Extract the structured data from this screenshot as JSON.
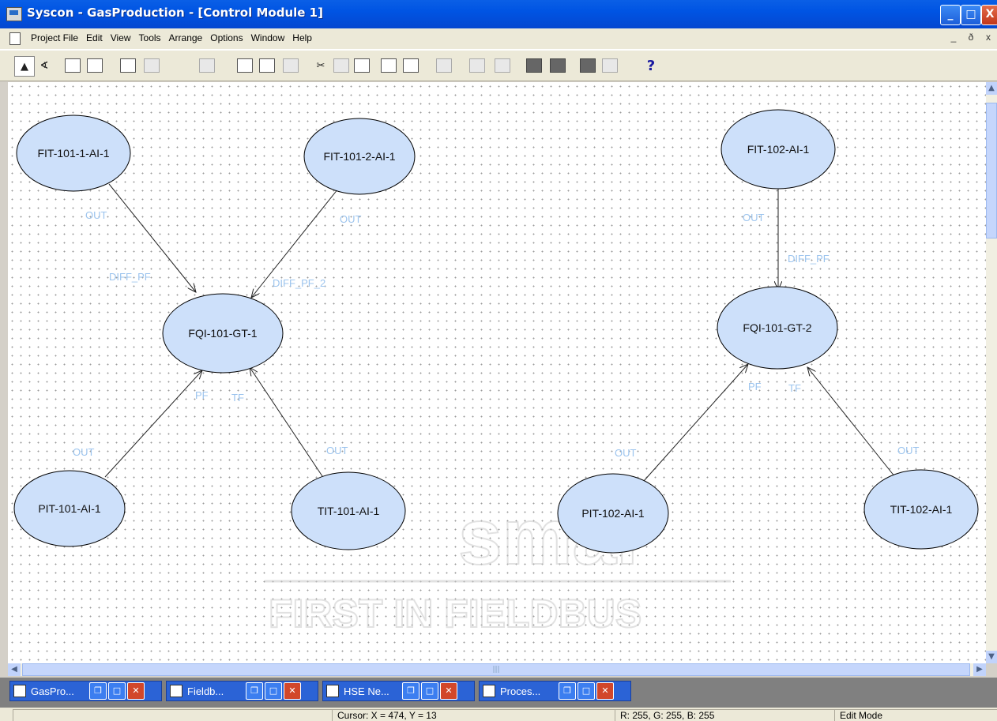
{
  "window": {
    "title": "Syscon - GasProduction - [Control Module 1]",
    "controls": [
      "_",
      "□",
      "X"
    ]
  },
  "menu": {
    "items": [
      "Project File",
      "Edit",
      "View",
      "Tools",
      "Arrange",
      "Options",
      "Window",
      "Help"
    ],
    "mdi_controls": [
      "_",
      "ð",
      "x"
    ]
  },
  "toolbar": {
    "buttons": [
      "pointer-tool-icon",
      "link-tool-icon",
      "text-tool-icon",
      "attach-icon",
      "copy-icon",
      "paste-icon",
      "grid-icon",
      "new-block-icon",
      "copy-block-icon",
      "paste-block-icon",
      "cut-icon",
      "connect-icon",
      "export-icon",
      "print-icon",
      "preview-icon",
      "monitor-icon",
      "order-icon",
      "align-icon",
      "stop-icon",
      "refresh-icon",
      "block-icon",
      "zoom-icon",
      "help-icon"
    ],
    "help_label": "?"
  },
  "diagram": {
    "blocks": [
      {
        "id": "b1",
        "label": "FIT-101-1-AI-1"
      },
      {
        "id": "b2",
        "label": "FIT-101-2-AI-1"
      },
      {
        "id": "b3",
        "label": "FQI-101-GT-1"
      },
      {
        "id": "b4",
        "label": "PIT-101-AI-1"
      },
      {
        "id": "b5",
        "label": "TIT-101-AI-1"
      },
      {
        "id": "b6",
        "label": "FIT-102-AI-1"
      },
      {
        "id": "b7",
        "label": "FQI-101-GT-2"
      },
      {
        "id": "b8",
        "label": "PIT-102-AI-1"
      },
      {
        "id": "b9",
        "label": "TIT-102-AI-1"
      }
    ],
    "port_labels": {
      "l1": "OUT",
      "l2": "OUT",
      "l3": "DIFF_PF",
      "l4": "DIFF_PF_2",
      "l5": "PF",
      "l6": "TF",
      "l7": "OUT",
      "l8": "OUT",
      "l9": "OUT",
      "l10": "DIFF_PF",
      "l11": "PF",
      "l12": "TF",
      "l13": "OUT",
      "l14": "OUT"
    },
    "watermark": {
      "brand": "smar",
      "tagline": "FIRST IN FIELDBUS"
    }
  },
  "mdi_windows": [
    {
      "label": "GasPro...",
      "active": true
    },
    {
      "label": "Fieldb..."
    },
    {
      "label": "HSE Ne..."
    },
    {
      "label": "Proces..."
    }
  ],
  "status": {
    "cursor": "Cursor: X = 474, Y = 13",
    "color": "R: 255, G: 255, B: 255",
    "mode": "Edit Mode"
  },
  "colors": {
    "block_fill": "#cde0fa",
    "port_label": "#9cc4ee",
    "titlebar": "#0054e3"
  }
}
